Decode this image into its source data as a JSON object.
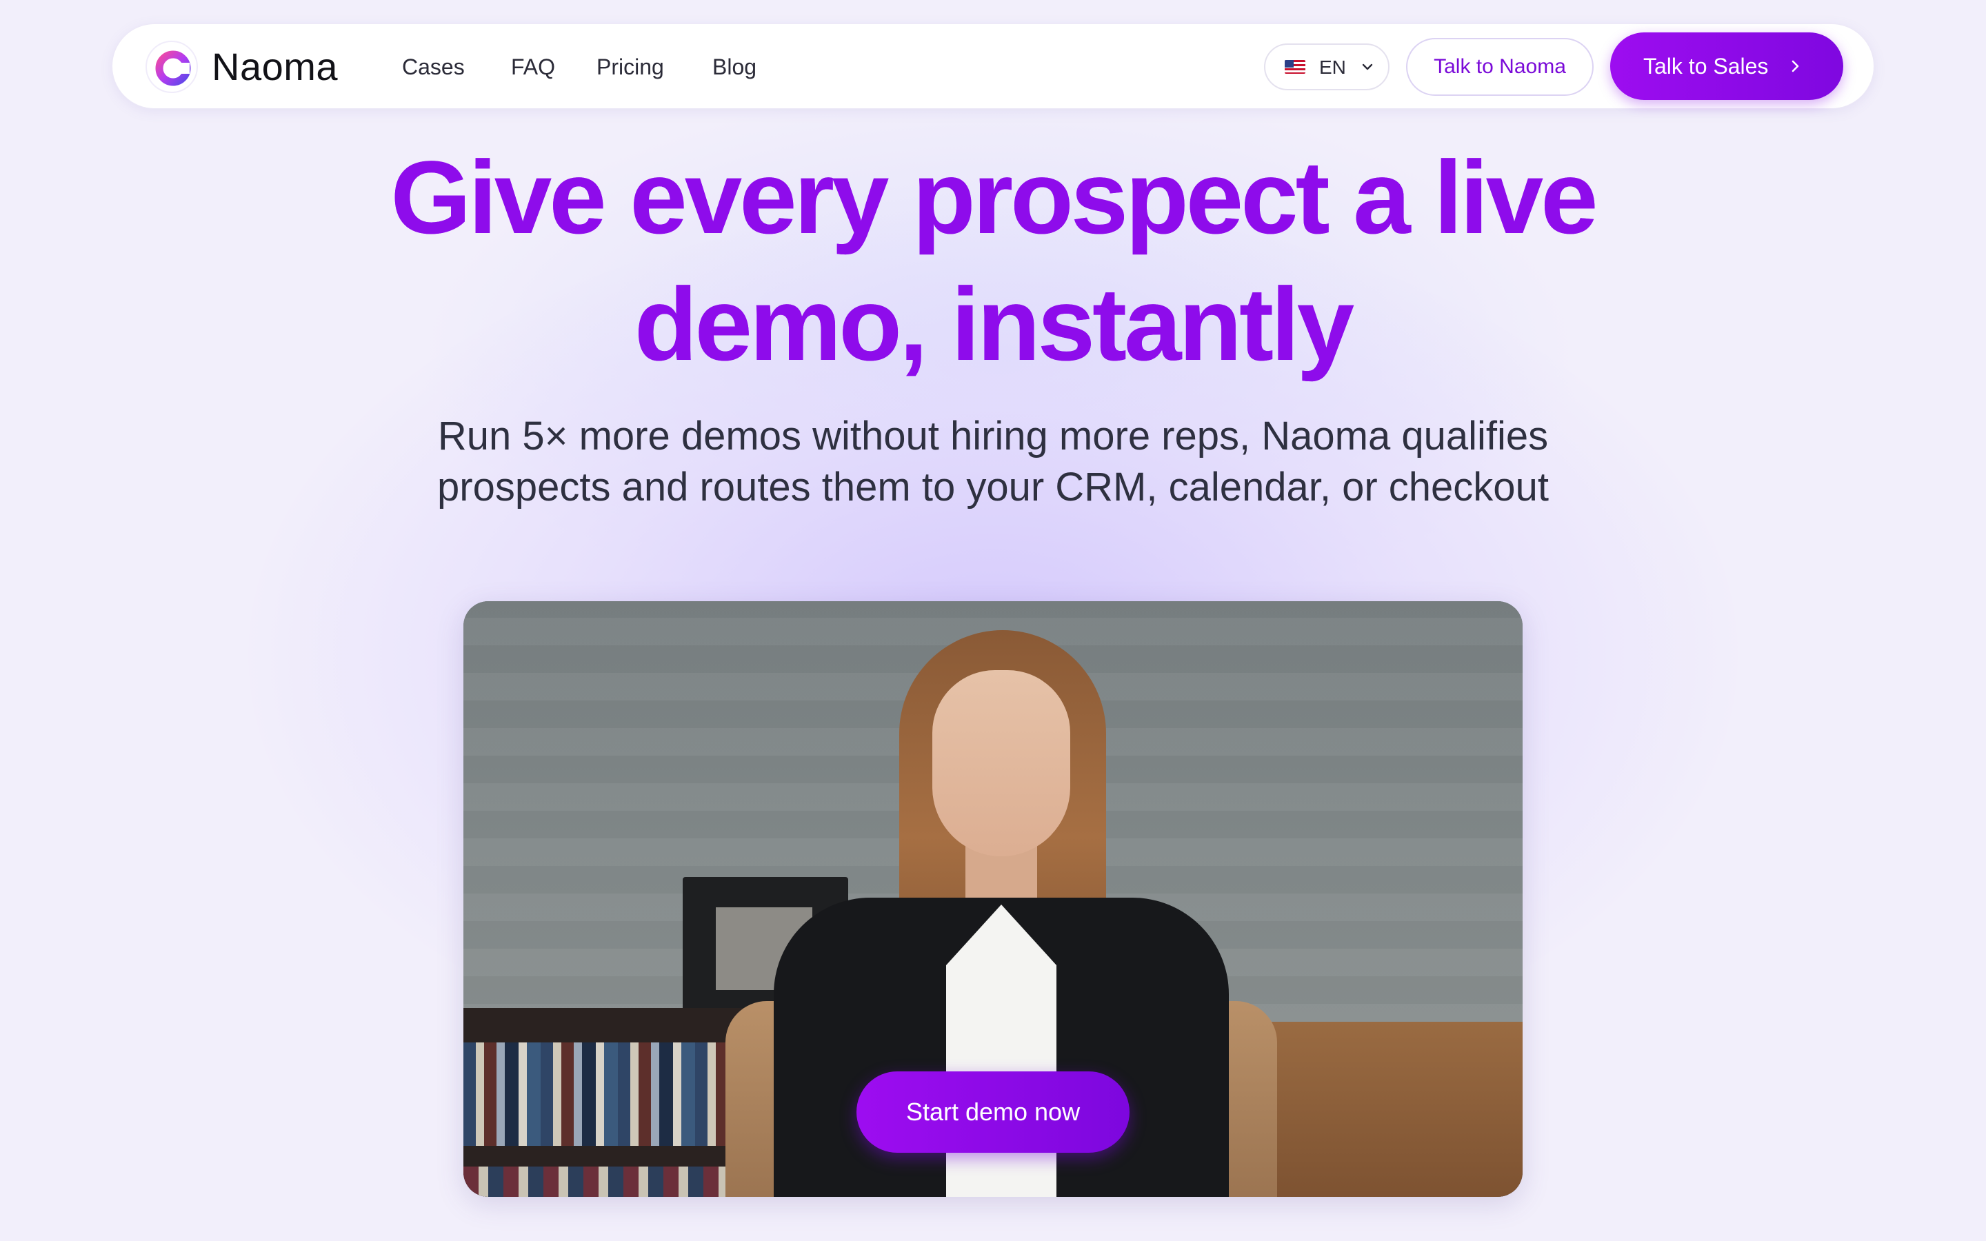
{
  "header": {
    "brand": "Naoma",
    "nav": [
      {
        "label": "Cases"
      },
      {
        "label": "FAQ"
      },
      {
        "label": "Pricing"
      },
      {
        "label": "Blog"
      }
    ],
    "language": "EN",
    "talk_to_naoma": "Talk to Naoma",
    "talk_to_sales": "Talk to Sales"
  },
  "hero": {
    "title_line1": "Give every prospect a live",
    "title_line2": "demo, instantly",
    "subtitle_line1": "Run 5× more demos without hiring more reps, Naoma qualifies",
    "subtitle_line2": "prospects and routes them to your CRM, calendar, or checkout"
  },
  "video": {
    "cta": "Start demo now"
  },
  "colors": {
    "accent": "#8E0CEB",
    "background": "#F2EFFB",
    "text": "#2E3040"
  },
  "icons": [
    "naoma-logo-icon",
    "us-flag-icon",
    "chevron-down-icon",
    "chevron-right-icon"
  ]
}
